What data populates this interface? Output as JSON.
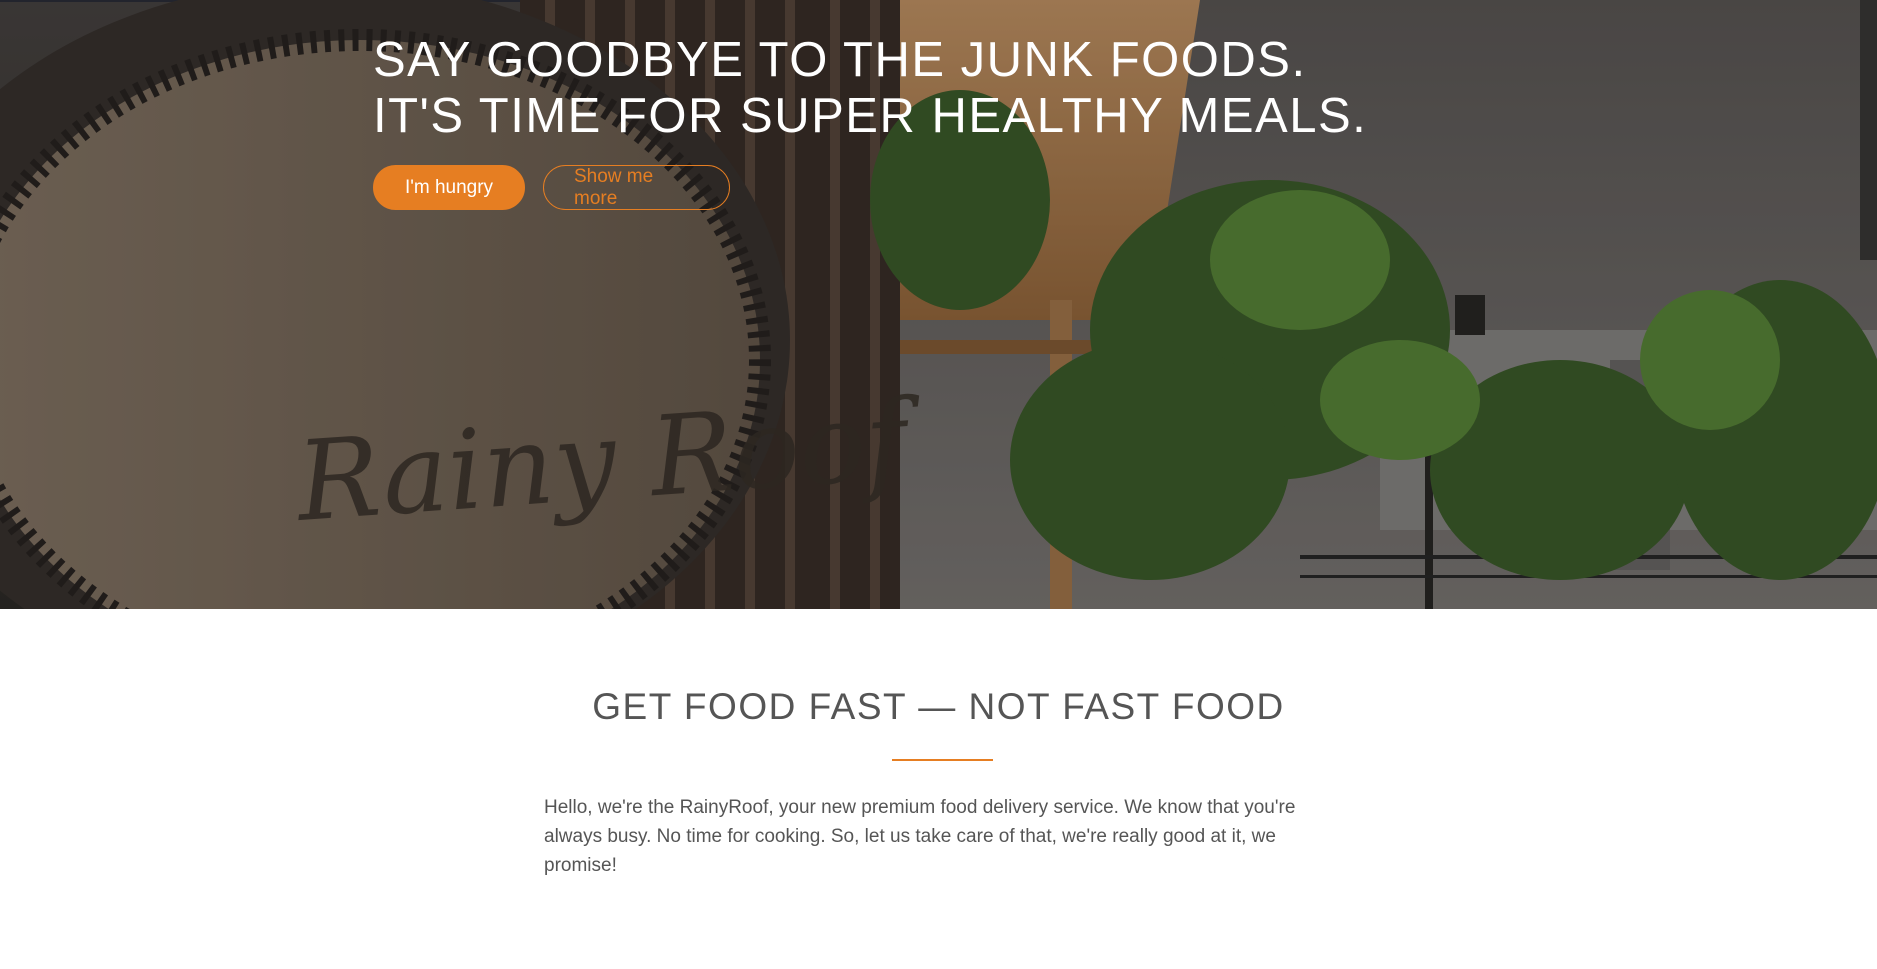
{
  "hero": {
    "title_line1": "SAY GOODBYE TO THE JUNK FOODS.",
    "title_line2": "IT'S TIME FOR SUPER HEALTHY MEALS.",
    "primary_button": "I'm hungry",
    "secondary_button": "Show me more",
    "accent_color": "#e67e22"
  },
  "about": {
    "title": "GET FOOD FAST — NOT FAST FOOD",
    "text": "Hello, we're the RainyRoof, your new premium food delivery service. We know that you're always busy. No time for cooking. So, let us take care of that, we're really good at it, we promise!"
  }
}
